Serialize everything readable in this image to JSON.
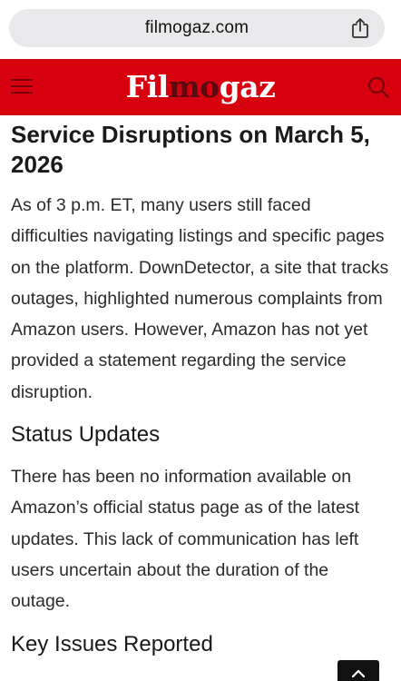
{
  "browser": {
    "url": "filmogaz.com"
  },
  "site": {
    "logo": {
      "part1": "Fil",
      "part2": "mo",
      "part3": "gaz"
    }
  },
  "article": {
    "title": "Service Disruptions on March 5, 2026",
    "paragraph1": "As of 3 p.m. ET, many users still faced difficulties navigating listings and specific pages on the platform. DownDetector, a site that tracks outages, highlighted numerous complaints from Amazon users. However, Amazon has not yet provided a statement regarding the service disruption.",
    "heading_status": "Status Updates",
    "paragraph2": "There has been no information available on Amazon’s official status page as of the latest updates. This lack of communication has left users uncertain about the duration of the outage.",
    "heading_issues": "Key Issues Reported"
  },
  "icons": {
    "share": "share-icon",
    "menu": "hamburger-menu-icon",
    "search": "search-icon",
    "back_to_top": "chevron-up-icon"
  },
  "colors": {
    "header_bg": "#d6000f",
    "logo_accent": "#5a0a10",
    "url_pill": "#e9e9eb"
  }
}
